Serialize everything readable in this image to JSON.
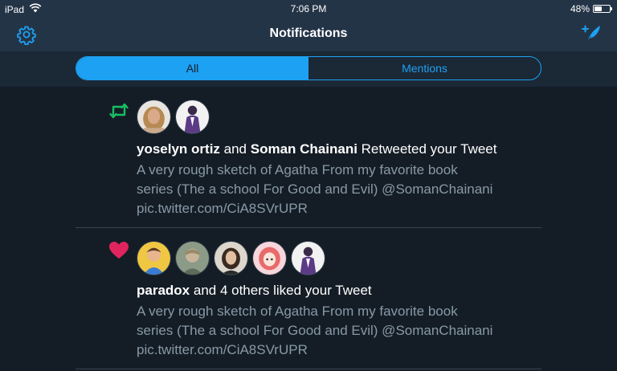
{
  "status_bar": {
    "device": "iPad",
    "time": "7:06 PM",
    "battery_text": "48%",
    "battery_level": 0.48
  },
  "nav": {
    "title": "Notifications",
    "settings_icon": "gear-icon",
    "compose_icon": "compose-tweet-icon"
  },
  "tabs": [
    {
      "label": "All",
      "active": true
    },
    {
      "label": "Mentions",
      "active": false
    }
  ],
  "notifications": [
    {
      "type_icon": "retweet-icon",
      "actor1": "yoselyn ortiz",
      "conj": " and ",
      "actor2": "Soman Chainani",
      "action": " Retweeted your Tweet",
      "tweet_lines": [
        "A very rough sketch of Agatha From my favorite book",
        "series (The a school For Good and Evil) @SomanChainani",
        "pic.twitter.com/CiA8SVrUPR"
      ]
    },
    {
      "type_icon": "heart-icon",
      "actor1": "paradox",
      "action": " and 4 others liked your Tweet",
      "tweet_lines": [
        "A very rough sketch of Agatha From my favorite book",
        "series (The a school For Good and Evil) @SomanChainani",
        "pic.twitter.com/CiA8SVrUPR"
      ]
    }
  ],
  "colors": {
    "accent": "#1da1f2",
    "retweet": "#17bf63",
    "like": "#e0245e",
    "background": "#141d26",
    "bar": "#243447",
    "secondary_text": "#8899a6"
  }
}
